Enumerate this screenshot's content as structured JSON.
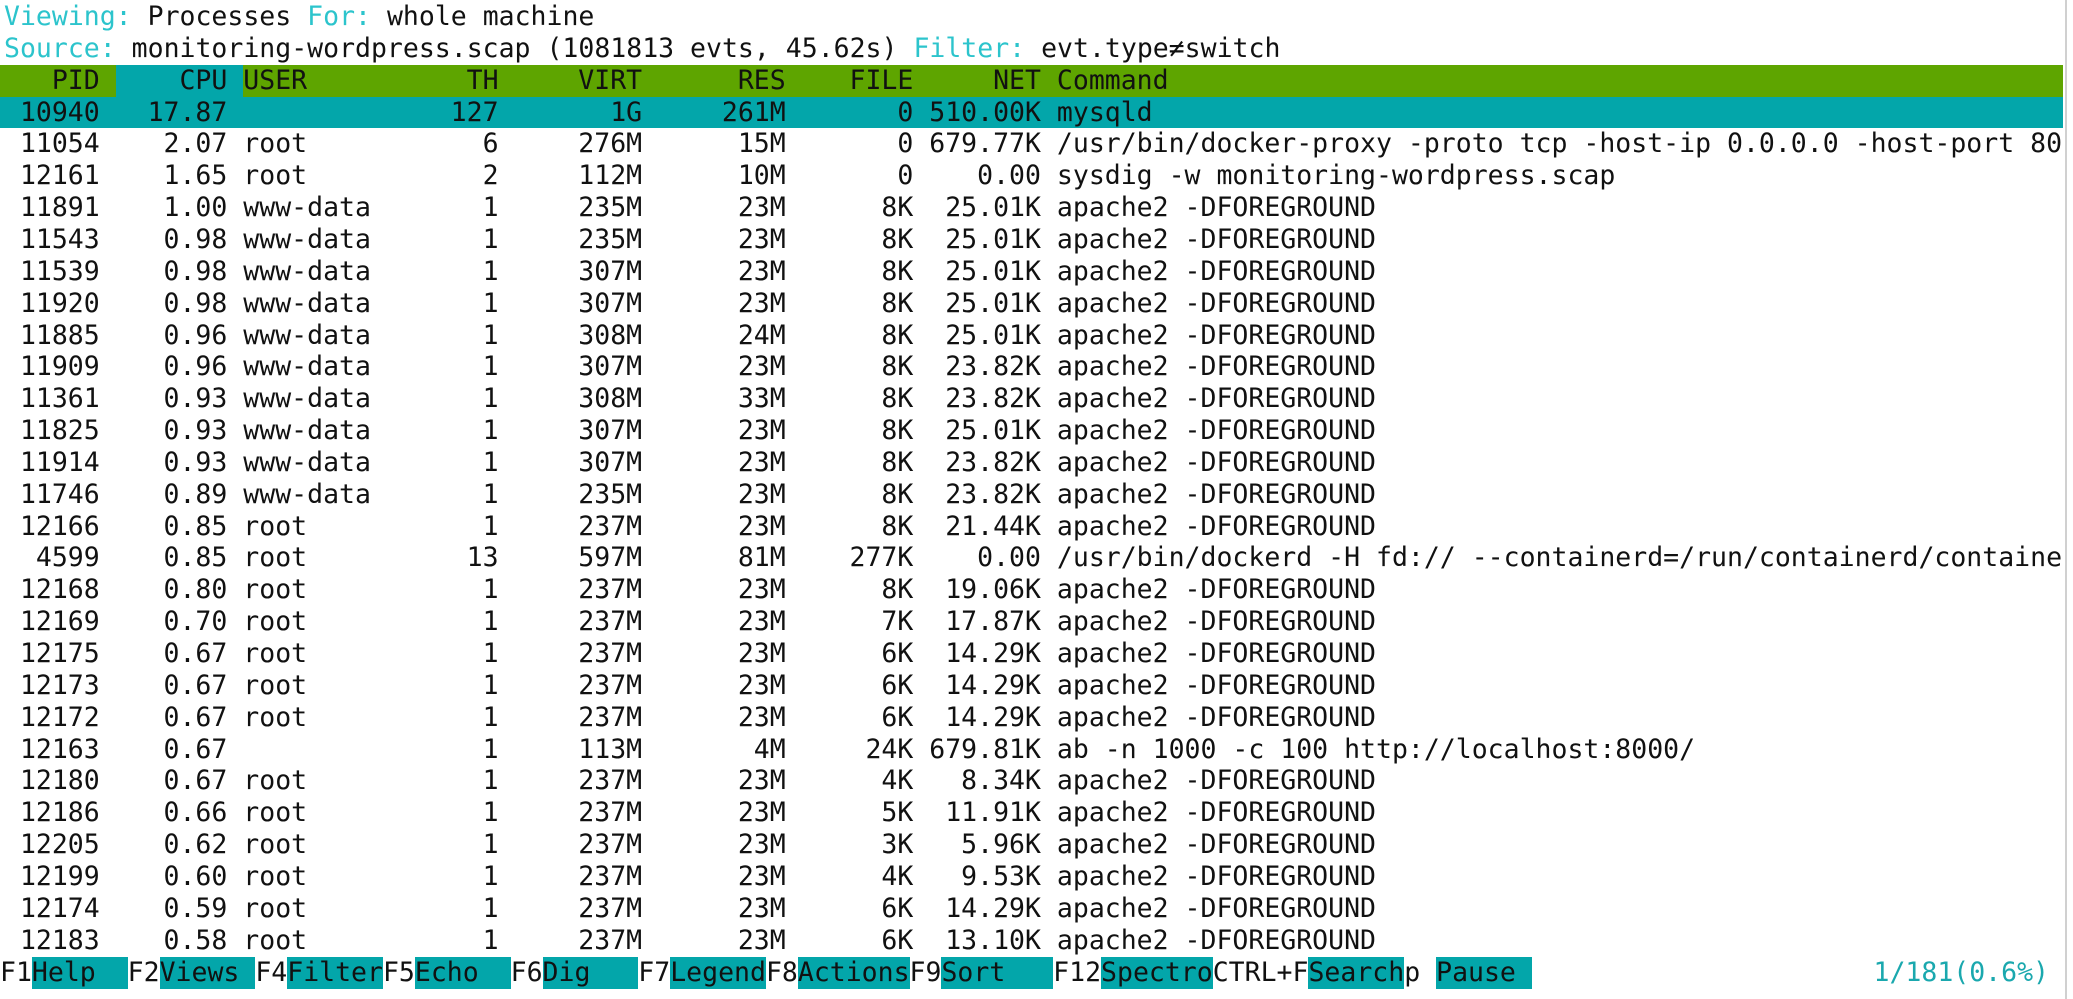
{
  "info": {
    "viewing_label": "Viewing:",
    "viewing_value": "Processes",
    "for_label": "For:",
    "for_value": "whole machine",
    "source_label": "Source:",
    "source_value": "monitoring-wordpress.scap (1081813 evts, 45.62s)",
    "filter_label": "Filter:",
    "filter_value": "evt.type≠switch"
  },
  "columns": {
    "pid": "PID",
    "cpu": "CPU",
    "user": "USER",
    "th": "TH",
    "virt": "VIRT",
    "res": "RES",
    "file": "FILE",
    "net": "NET",
    "command": "Command"
  },
  "sort_column": "cpu",
  "selected_row": 0,
  "rows": [
    {
      "pid": "10940",
      "cpu": "17.87",
      "user": "",
      "th": "127",
      "virt": "1G",
      "res": "261M",
      "file": "0",
      "net": "510.00K",
      "command": "mysqld"
    },
    {
      "pid": "11054",
      "cpu": "2.07",
      "user": "root",
      "th": "6",
      "virt": "276M",
      "res": "15M",
      "file": "0",
      "net": "679.77K",
      "command": "/usr/bin/docker-proxy -proto tcp -host-ip 0.0.0.0 -host-port 80"
    },
    {
      "pid": "12161",
      "cpu": "1.65",
      "user": "root",
      "th": "2",
      "virt": "112M",
      "res": "10M",
      "file": "0",
      "net": "0.00",
      "command": "sysdig -w monitoring-wordpress.scap"
    },
    {
      "pid": "11891",
      "cpu": "1.00",
      "user": "www-data",
      "th": "1",
      "virt": "235M",
      "res": "23M",
      "file": "8K",
      "net": "25.01K",
      "command": "apache2 -DFOREGROUND"
    },
    {
      "pid": "11543",
      "cpu": "0.98",
      "user": "www-data",
      "th": "1",
      "virt": "235M",
      "res": "23M",
      "file": "8K",
      "net": "25.01K",
      "command": "apache2 -DFOREGROUND"
    },
    {
      "pid": "11539",
      "cpu": "0.98",
      "user": "www-data",
      "th": "1",
      "virt": "307M",
      "res": "23M",
      "file": "8K",
      "net": "25.01K",
      "command": "apache2 -DFOREGROUND"
    },
    {
      "pid": "11920",
      "cpu": "0.98",
      "user": "www-data",
      "th": "1",
      "virt": "307M",
      "res": "23M",
      "file": "8K",
      "net": "25.01K",
      "command": "apache2 -DFOREGROUND"
    },
    {
      "pid": "11885",
      "cpu": "0.96",
      "user": "www-data",
      "th": "1",
      "virt": "308M",
      "res": "24M",
      "file": "8K",
      "net": "25.01K",
      "command": "apache2 -DFOREGROUND"
    },
    {
      "pid": "11909",
      "cpu": "0.96",
      "user": "www-data",
      "th": "1",
      "virt": "307M",
      "res": "23M",
      "file": "8K",
      "net": "23.82K",
      "command": "apache2 -DFOREGROUND"
    },
    {
      "pid": "11361",
      "cpu": "0.93",
      "user": "www-data",
      "th": "1",
      "virt": "308M",
      "res": "33M",
      "file": "8K",
      "net": "23.82K",
      "command": "apache2 -DFOREGROUND"
    },
    {
      "pid": "11825",
      "cpu": "0.93",
      "user": "www-data",
      "th": "1",
      "virt": "307M",
      "res": "23M",
      "file": "8K",
      "net": "25.01K",
      "command": "apache2 -DFOREGROUND"
    },
    {
      "pid": "11914",
      "cpu": "0.93",
      "user": "www-data",
      "th": "1",
      "virt": "307M",
      "res": "23M",
      "file": "8K",
      "net": "23.82K",
      "command": "apache2 -DFOREGROUND"
    },
    {
      "pid": "11746",
      "cpu": "0.89",
      "user": "www-data",
      "th": "1",
      "virt": "235M",
      "res": "23M",
      "file": "8K",
      "net": "23.82K",
      "command": "apache2 -DFOREGROUND"
    },
    {
      "pid": "12166",
      "cpu": "0.85",
      "user": "root",
      "th": "1",
      "virt": "237M",
      "res": "23M",
      "file": "8K",
      "net": "21.44K",
      "command": "apache2 -DFOREGROUND"
    },
    {
      "pid": "4599",
      "cpu": "0.85",
      "user": "root",
      "th": "13",
      "virt": "597M",
      "res": "81M",
      "file": "277K",
      "net": "0.00",
      "command": "/usr/bin/dockerd -H fd:// --containerd=/run/containerd/containe"
    },
    {
      "pid": "12168",
      "cpu": "0.80",
      "user": "root",
      "th": "1",
      "virt": "237M",
      "res": "23M",
      "file": "8K",
      "net": "19.06K",
      "command": "apache2 -DFOREGROUND"
    },
    {
      "pid": "12169",
      "cpu": "0.70",
      "user": "root",
      "th": "1",
      "virt": "237M",
      "res": "23M",
      "file": "7K",
      "net": "17.87K",
      "command": "apache2 -DFOREGROUND"
    },
    {
      "pid": "12175",
      "cpu": "0.67",
      "user": "root",
      "th": "1",
      "virt": "237M",
      "res": "23M",
      "file": "6K",
      "net": "14.29K",
      "command": "apache2 -DFOREGROUND"
    },
    {
      "pid": "12173",
      "cpu": "0.67",
      "user": "root",
      "th": "1",
      "virt": "237M",
      "res": "23M",
      "file": "6K",
      "net": "14.29K",
      "command": "apache2 -DFOREGROUND"
    },
    {
      "pid": "12172",
      "cpu": "0.67",
      "user": "root",
      "th": "1",
      "virt": "237M",
      "res": "23M",
      "file": "6K",
      "net": "14.29K",
      "command": "apache2 -DFOREGROUND"
    },
    {
      "pid": "12163",
      "cpu": "0.67",
      "user": "",
      "th": "1",
      "virt": "113M",
      "res": "4M",
      "file": "24K",
      "net": "679.81K",
      "command": "ab -n 1000 -c 100 http://localhost:8000/"
    },
    {
      "pid": "12180",
      "cpu": "0.67",
      "user": "root",
      "th": "1",
      "virt": "237M",
      "res": "23M",
      "file": "4K",
      "net": "8.34K",
      "command": "apache2 -DFOREGROUND"
    },
    {
      "pid": "12186",
      "cpu": "0.66",
      "user": "root",
      "th": "1",
      "virt": "237M",
      "res": "23M",
      "file": "5K",
      "net": "11.91K",
      "command": "apache2 -DFOREGROUND"
    },
    {
      "pid": "12205",
      "cpu": "0.62",
      "user": "root",
      "th": "1",
      "virt": "237M",
      "res": "23M",
      "file": "3K",
      "net": "5.96K",
      "command": "apache2 -DFOREGROUND"
    },
    {
      "pid": "12199",
      "cpu": "0.60",
      "user": "root",
      "th": "1",
      "virt": "237M",
      "res": "23M",
      "file": "4K",
      "net": "9.53K",
      "command": "apache2 -DFOREGROUND"
    },
    {
      "pid": "12174",
      "cpu": "0.59",
      "user": "root",
      "th": "1",
      "virt": "237M",
      "res": "23M",
      "file": "6K",
      "net": "14.29K",
      "command": "apache2 -DFOREGROUND"
    },
    {
      "pid": "12183",
      "cpu": "0.58",
      "user": "root",
      "th": "1",
      "virt": "237M",
      "res": "23M",
      "file": "6K",
      "net": "13.10K",
      "command": "apache2 -DFOREGROUND"
    }
  ],
  "footer": {
    "keys": [
      {
        "key": "F1",
        "label": "Help  "
      },
      {
        "key": "F2",
        "label": "Views "
      },
      {
        "key": "F4",
        "label": "Filter"
      },
      {
        "key": "F5",
        "label": "Echo  "
      },
      {
        "key": "F6",
        "label": "Dig   "
      },
      {
        "key": "F7",
        "label": "Legend"
      },
      {
        "key": "F8",
        "label": "Actions"
      },
      {
        "key": "F9",
        "label": "Sort   "
      },
      {
        "key": "F12",
        "label": "Spectro"
      },
      {
        "key": "CTRL+F",
        "label": "Search"
      },
      {
        "key": "p ",
        "label": "Pause "
      }
    ],
    "status": "1/181(0.6%)"
  },
  "colors": {
    "header_bg": "#5ea500",
    "selection_bg": "#03a6aa",
    "label_cyan": "#2cc4cc"
  }
}
